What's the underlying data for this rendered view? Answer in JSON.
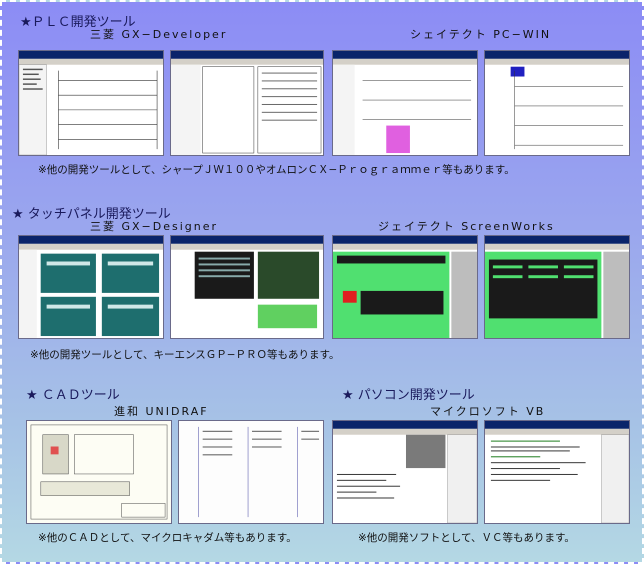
{
  "sections": {
    "plc": {
      "title": "★ＰＬＣ開発ツール",
      "tool1": "三菱 GX−Developer",
      "tool2": "シェイテクト PC−WIN",
      "note": "※他の開発ツールとして、シャープＪＷ１００やオムロンＣＸ−Ｐｒｏｇｒａｍｍｅｒ等もあります。"
    },
    "touch": {
      "title": "★ タッチパネル開発ツール",
      "tool1": "三菱 GX−Designer",
      "tool2": "ジェイテクト ScreenWorks",
      "note": "※他の開発ツールとして、キーエンスＧＰ−ＰＲＯ等もあります。"
    },
    "cad": {
      "title": "★ ＣＡＤツール",
      "tool1": "進和  UNIDRAF",
      "note": "※他のＣＡＤとして、マイクロキャダム等もあります。"
    },
    "pc": {
      "title": "★ パソコン開発ツール",
      "tool1": "マイクロソフト VB",
      "note": "※他の開発ソフトとして、ＶＣ等もあります。"
    }
  },
  "colors": {
    "background_top": "#8c8cf5",
    "background_bottom": "#b4d8e4",
    "heading": "#1a1a5c"
  }
}
